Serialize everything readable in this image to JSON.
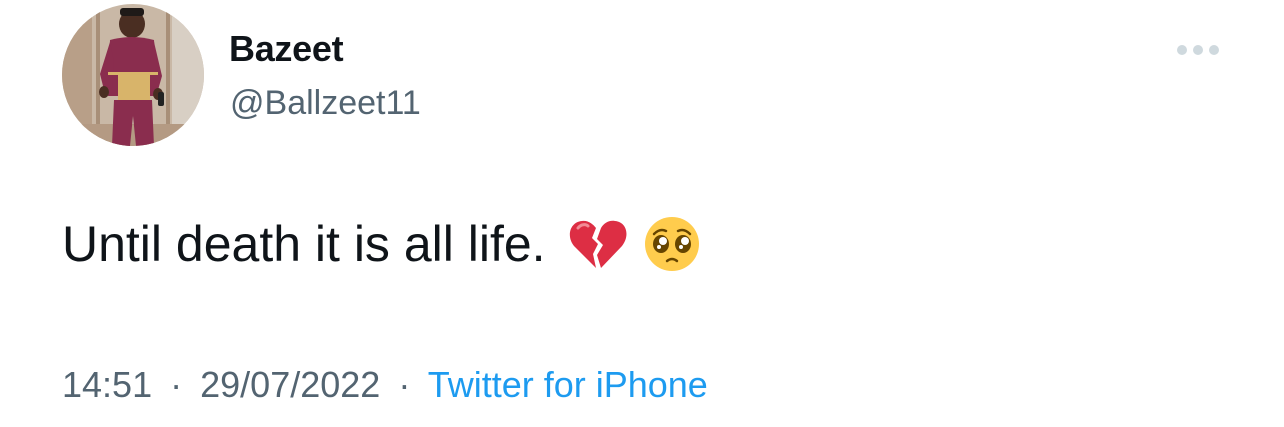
{
  "user": {
    "display_name": "Bazeet",
    "handle": "@Ballzeet11",
    "avatar": "avatar-photo"
  },
  "tweet": {
    "text": "Until death it is all life.",
    "emojis": [
      "broken-heart-emoji",
      "pleading-face-emoji"
    ]
  },
  "meta": {
    "time": "14:51",
    "separator": "·",
    "date": "29/07/2022",
    "source": "Twitter for iPhone"
  },
  "actions": {
    "more_icon": "more-dots-icon"
  },
  "colors": {
    "text_primary": "#0f1419",
    "text_secondary": "#536471",
    "link": "#1d9bf0",
    "icon_gray": "#cfd9de"
  }
}
